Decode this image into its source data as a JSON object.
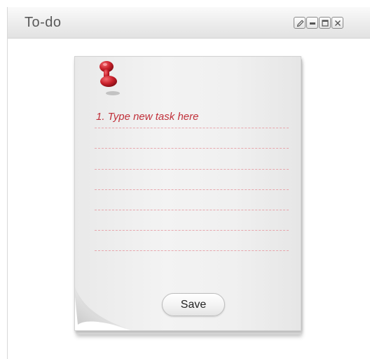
{
  "window": {
    "title": "To-do",
    "controls": [
      {
        "name": "edit",
        "icon": "pencil-icon"
      },
      {
        "name": "minimize",
        "icon": "minimize-icon"
      },
      {
        "name": "maximize",
        "icon": "maximize-icon"
      },
      {
        "name": "close",
        "icon": "close-icon"
      }
    ]
  },
  "note": {
    "tasks": [
      "1. Type new task here",
      "",
      "",
      "",
      "",
      "",
      ""
    ],
    "save_label": "Save",
    "pin_icon": "pushpin-icon"
  },
  "colors": {
    "task_text": "#c0303a",
    "line": "#e7a7ad",
    "pin": "#c8202a"
  }
}
